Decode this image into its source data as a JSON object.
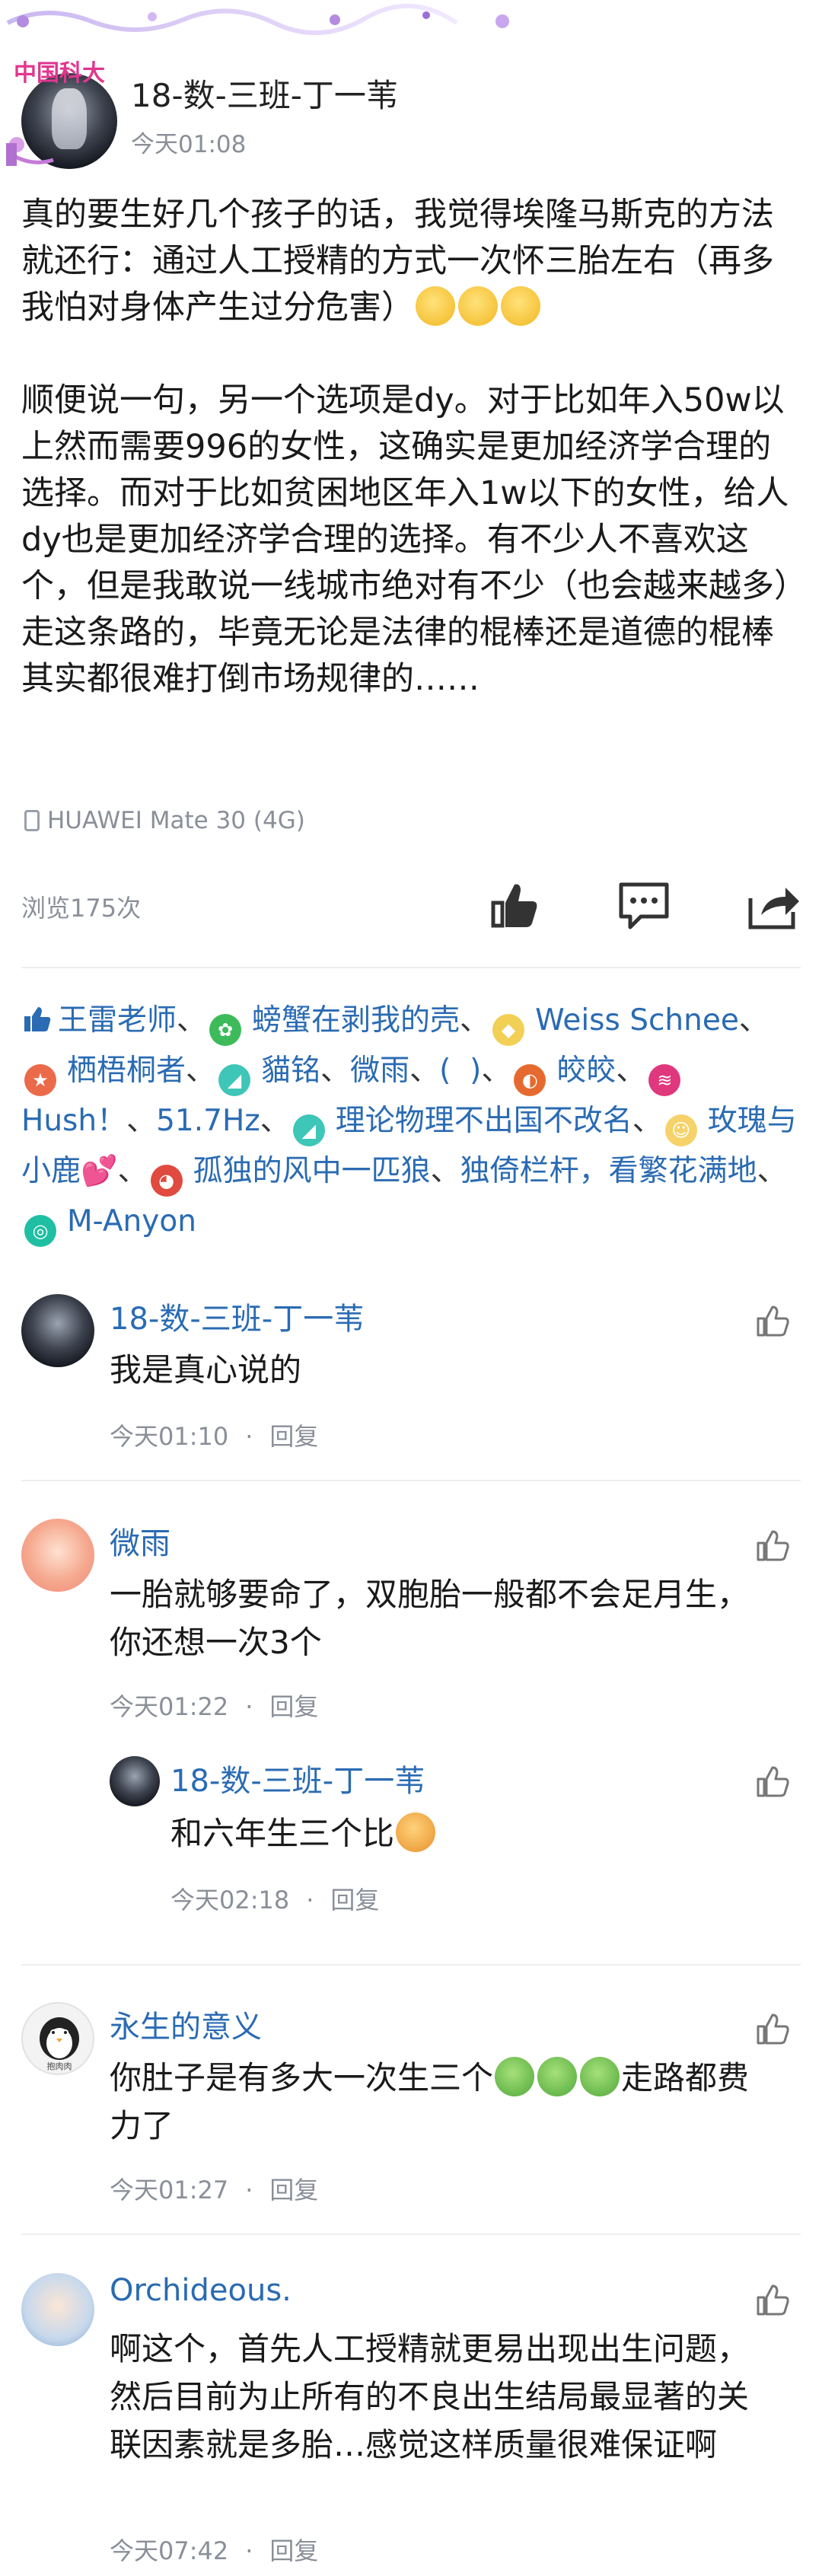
{
  "colors": {
    "link": "#2a6bb3",
    "muted": "#8a8f99",
    "text": "#1a1a1a"
  },
  "post": {
    "author": "18-数-三班-丁一苇",
    "time": "今天01:08",
    "badge_text": "中国科大",
    "body": [
      "真的要生好几个孩子的话，我觉得埃隆马斯克的方法就还行：通过人工授精的方式一次怀三胎左右（再多我怕对身体产生过分危害）",
      "顺便说一句，另一个选项是dy。对于比如年入50w以上然而需要996的女性，这确实是更加经济学合理的选择。而对于比如贫困地区年入1w以下的女性，给人dy也是更加经济学合理的选择。有不少人不喜欢这个，但是我敢说一线城市绝对有不少（也会越来越多）走这条路的，毕竟无论是法律的棍棒还是道德的棍棒其实都很难打倒市场规律的……"
    ],
    "device": "HUAWEI Mate 30 (4G)",
    "views": "浏览175次",
    "actions": [
      "thumb-up-icon",
      "comment-icon",
      "share-icon"
    ]
  },
  "likes": {
    "users": [
      {
        "name": "王雷老师"
      },
      {
        "name": "螃蟹在剥我的壳"
      },
      {
        "name": "Weiss Schnee"
      },
      {
        "name": "栖梧桐者"
      },
      {
        "name": "貓铭"
      },
      {
        "name": "微雨"
      },
      {
        "name": "(⁠ ⁠ ⁠)"
      },
      {
        "name": "皎皎"
      },
      {
        "name": "Hush！"
      },
      {
        "name": "51.7Hz"
      },
      {
        "name": "理论物理不出国不改名"
      },
      {
        "name": "玫瑰与小鹿💕"
      },
      {
        "name": "孤独的风中一匹狼"
      },
      {
        "name": "独倚栏杆，看繁花满地"
      },
      {
        "name": "M-Anyon"
      }
    ]
  },
  "comments": [
    {
      "name": "18-数-三班-丁一苇",
      "text": "我是真心说的",
      "time": "今天01:10",
      "reply": "回复"
    },
    {
      "name": "微雨",
      "text": "一胎就够要命了，双胞胎一般都不会足月生，你还想一次3个",
      "time": "今天01:22",
      "reply": "回复",
      "sub": {
        "name": "18-数-三班-丁一苇",
        "text": "和六年生三个比",
        "time": "今天02:18",
        "reply": "回复"
      }
    },
    {
      "name": "永生的意义",
      "text_a": "你肚子是有多大一次生三个",
      "text_b": "走路都费力了",
      "avatar_text": "抱肉肉",
      "time": "今天01:27",
      "reply": "回复"
    },
    {
      "name": "Orchideous.",
      "text": "啊这个，首先人工授精就更易出现出生问题，然后目前为止所有的不良出生结局最显著的关联因素就是多胎…感觉这样质量很难保证啊",
      "time": "今天07:42",
      "reply": "回复"
    }
  ]
}
